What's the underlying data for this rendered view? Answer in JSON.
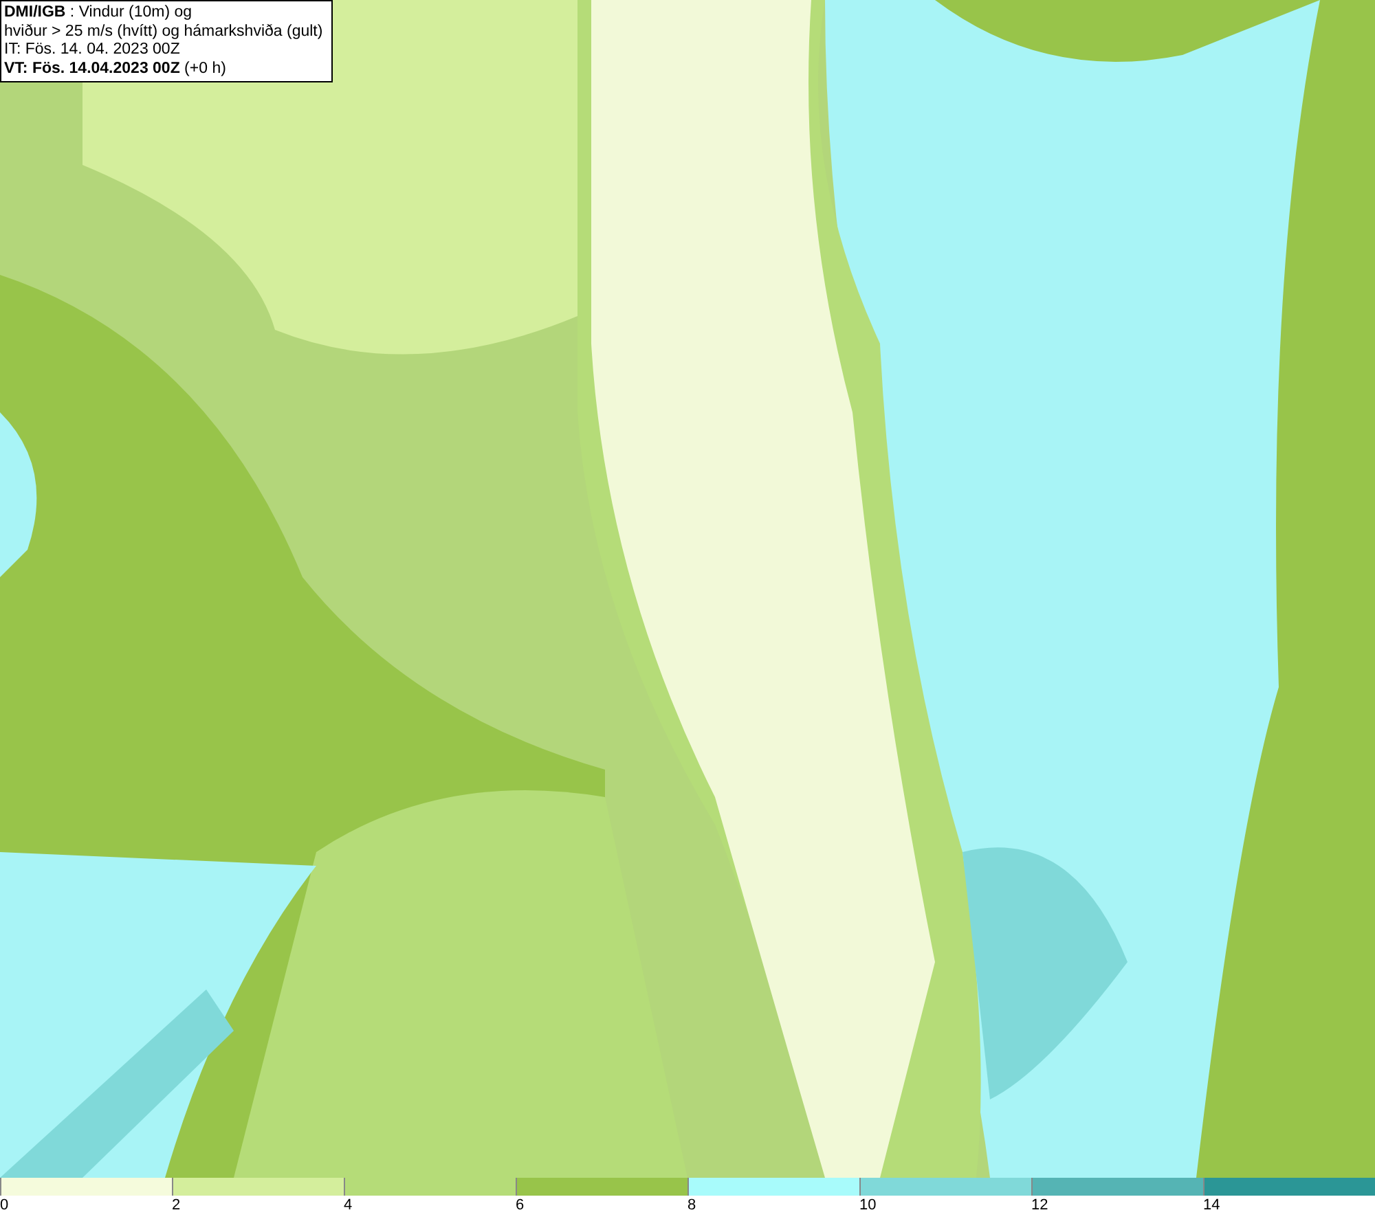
{
  "header": {
    "lines": [
      "**DMI/IGB** : Vindur (10m) og",
      "hviður > 25 m/s (hvítt) og hámarkshviða (gult)",
      "IT: Fös. 14. 04. 2023 00Z",
      "**VT: Fös. 14.04.2023 00Z** (+0 h)"
    ]
  },
  "legend": {
    "bins": [
      {
        "label": "0",
        "color": "#f5fbdc"
      },
      {
        "label": "2",
        "color": "#d4ee9c"
      },
      {
        "label": "4",
        "color": "#b5dc78"
      },
      {
        "label": "6",
        "color": "#98c44a"
      },
      {
        "label": "8",
        "color": "#a8fbfb"
      },
      {
        "label": "10",
        "color": "#80d9d9"
      },
      {
        "label": "12",
        "color": "#55b4b4"
      },
      {
        "label": "14",
        "color": "#2b9696"
      }
    ]
  }
}
